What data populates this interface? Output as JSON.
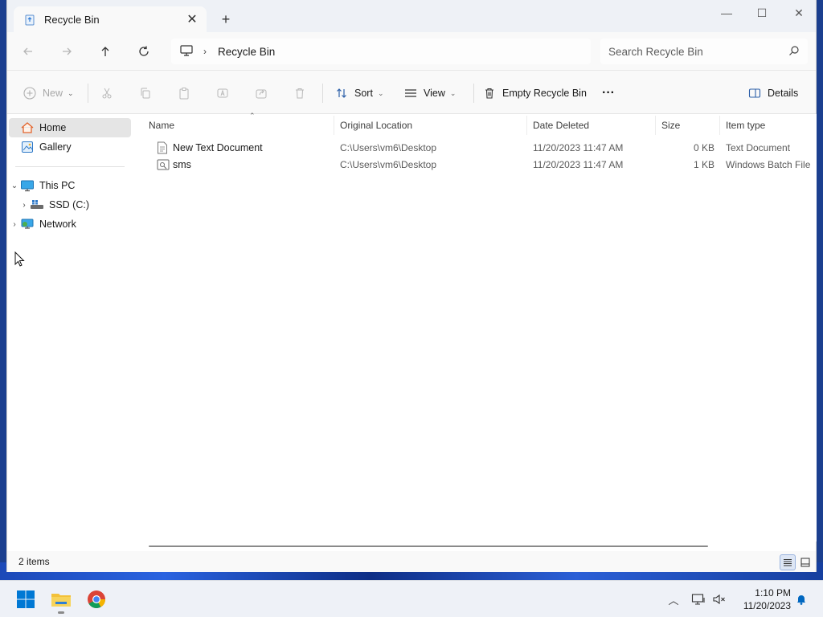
{
  "window": {
    "tab_title": "Recycle Bin",
    "tab_close_glyph": "✕",
    "new_tab_glyph": "+",
    "minimize_glyph": "—",
    "maximize_glyph": "☐",
    "close_glyph": "✕"
  },
  "address": {
    "separator": "›",
    "crumb": "Recycle Bin"
  },
  "search": {
    "placeholder": "Search Recycle Bin"
  },
  "toolbar": {
    "new_label": "New",
    "sort_label": "Sort",
    "view_label": "View",
    "empty_label": "Empty Recycle Bin",
    "more_glyph": "···",
    "details_label": "Details",
    "caret": "⌄"
  },
  "sidebar": {
    "home": "Home",
    "gallery": "Gallery",
    "this_pc": "This PC",
    "ssd": "SSD (C:)",
    "network": "Network",
    "expanded_glyph": "⌄",
    "collapsed_glyph": "›"
  },
  "columns": {
    "name": "Name",
    "location": "Original Location",
    "date": "Date Deleted",
    "size": "Size",
    "type": "Item type",
    "sort_glyph": "⌃"
  },
  "files": [
    {
      "name": "New Text Document",
      "location": "C:\\Users\\vm6\\Desktop",
      "date": "11/20/2023 11:47 AM",
      "size": "0 KB",
      "type": "Text Document"
    },
    {
      "name": "sms",
      "location": "C:\\Users\\vm6\\Desktop",
      "date": "11/20/2023 11:47 AM",
      "size": "1 KB",
      "type": "Windows Batch File"
    }
  ],
  "status": {
    "count": "2 items"
  },
  "taskbar": {
    "tray_up_glyph": "︿",
    "time": "1:10 PM",
    "date": "11/20/2023"
  },
  "colors": {
    "accent": "#0067c0",
    "selection": "#e5e5e5",
    "start_blue": "#0078d4",
    "folder_yellow": "#f3c13a"
  }
}
